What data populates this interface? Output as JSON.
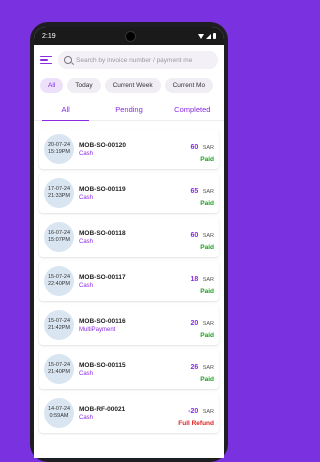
{
  "status_bar": {
    "time": "2:19"
  },
  "search": {
    "placeholder": "Search by invoice number / payment me"
  },
  "filters": [
    "All",
    "Today",
    "Current Week",
    "Current Mo"
  ],
  "tabs": [
    "All",
    "Pending",
    "Completed"
  ],
  "invoices": [
    {
      "date": "20-07-24",
      "time": "15:19PM",
      "number": "MOB-SO-00120",
      "method": "Cash",
      "amount": "60",
      "currency": "SAR",
      "status": "Paid"
    },
    {
      "date": "17-07-24",
      "time": "21:33PM",
      "number": "MOB-SO-00119",
      "method": "Cash",
      "amount": "65",
      "currency": "SAR",
      "status": "Paid"
    },
    {
      "date": "16-07-24",
      "time": "15:07PM",
      "number": "MOB-SO-00118",
      "method": "Cash",
      "amount": "60",
      "currency": "SAR",
      "status": "Paid"
    },
    {
      "date": "15-07-24",
      "time": "22:40PM",
      "number": "MOB-SO-00117",
      "method": "Cash",
      "amount": "18",
      "currency": "SAR",
      "status": "Paid"
    },
    {
      "date": "15-07-24",
      "time": "21:42PM",
      "number": "MOB-SO-00116",
      "method": "MultiPayment",
      "amount": "20",
      "currency": "SAR",
      "status": "Paid"
    },
    {
      "date": "15-07-24",
      "time": "21:40PM",
      "number": "MOB-SO-00115",
      "method": "Cash",
      "amount": "26",
      "currency": "SAR",
      "status": "Paid"
    },
    {
      "date": "14-07-24",
      "time": "0:59AM",
      "number": "MOB-RF-00021",
      "method": "Cash",
      "amount": "-20",
      "currency": "SAR",
      "status": "Full Refund"
    }
  ]
}
